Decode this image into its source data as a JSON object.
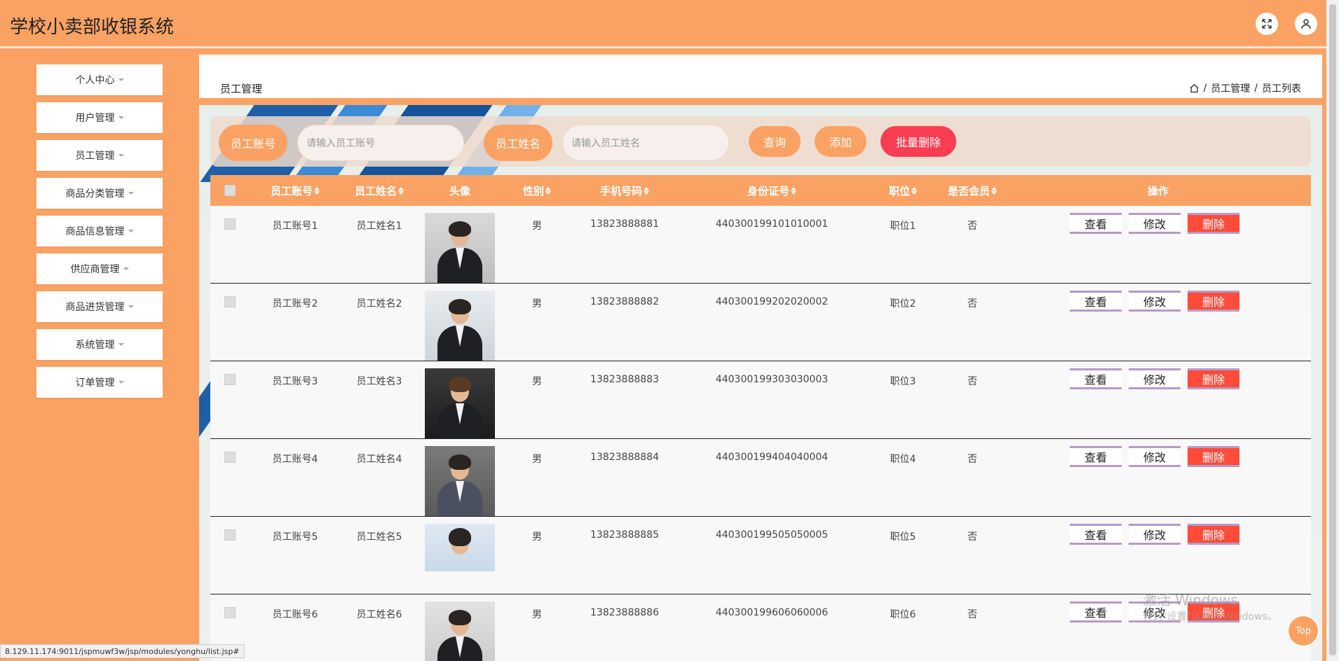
{
  "app": {
    "title": "学校小卖部收银系统"
  },
  "header_icons": [
    "fullscreen-icon",
    "user-icon"
  ],
  "sidebar": {
    "items": [
      {
        "label": "个人中心"
      },
      {
        "label": "用户管理"
      },
      {
        "label": "员工管理"
      },
      {
        "label": "商品分类管理"
      },
      {
        "label": "商品信息管理"
      },
      {
        "label": "供应商管理"
      },
      {
        "label": "商品进货管理"
      },
      {
        "label": "系统管理"
      },
      {
        "label": "订单管理"
      }
    ]
  },
  "page": {
    "heading": "员工管理",
    "breadcrumb": [
      "员工管理",
      "员工列表"
    ]
  },
  "search": {
    "account_label": "员工账号",
    "account_placeholder": "请输入员工账号",
    "name_label": "员工姓名",
    "name_placeholder": "请输入员工姓名",
    "query_label": "查询",
    "add_label": "添加",
    "batch_delete_label": "批量删除"
  },
  "table": {
    "columns": [
      "员工账号",
      "员工姓名",
      "头像",
      "性别",
      "手机号码",
      "身份证号",
      "职位",
      "是否会员",
      "操作"
    ],
    "actions": {
      "view": "查看",
      "edit": "修改",
      "delete": "删除"
    },
    "rows": [
      {
        "account": "员工账号1",
        "name": "员工姓名1",
        "gender": "男",
        "phone": "13823888881",
        "id_card": "440300199101010001",
        "position": "职位1",
        "member": "否"
      },
      {
        "account": "员工账号2",
        "name": "员工姓名2",
        "gender": "男",
        "phone": "13823888882",
        "id_card": "440300199202020002",
        "position": "职位2",
        "member": "否"
      },
      {
        "account": "员工账号3",
        "name": "员工姓名3",
        "gender": "男",
        "phone": "13823888883",
        "id_card": "440300199303030003",
        "position": "职位3",
        "member": "否"
      },
      {
        "account": "员工账号4",
        "name": "员工姓名4",
        "gender": "男",
        "phone": "13823888884",
        "id_card": "440300199404040004",
        "position": "职位4",
        "member": "否"
      },
      {
        "account": "员工账号5",
        "name": "员工姓名5",
        "gender": "男",
        "phone": "13823888885",
        "id_card": "440300199505050005",
        "position": "职位5",
        "member": "否"
      },
      {
        "account": "员工账号6",
        "name": "员工姓名6",
        "gender": "男",
        "phone": "13823888886",
        "id_card": "440300199606060006",
        "position": "职位6",
        "member": "否"
      }
    ]
  },
  "watermark": {
    "line1": "激活 Windows",
    "line2": "转到\"设置\"以激活 Windows。"
  },
  "top_button": "Top",
  "status_url": "8.129.11.174:9011/jspmuwf3w/jsp/modules/yonghu/list.jsp#",
  "colors": {
    "primary": "#faa264",
    "danger": "#ff4b3a",
    "batch_delete": "#f93d52"
  }
}
